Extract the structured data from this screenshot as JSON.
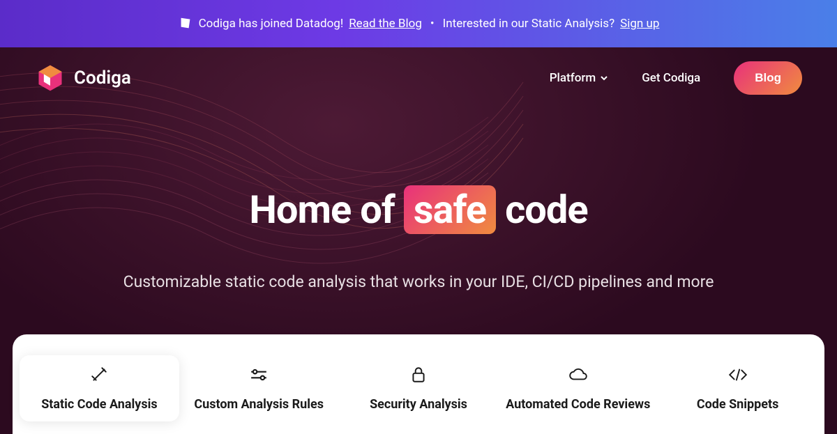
{
  "banner": {
    "joined_text": "Codiga has joined Datadog!",
    "read_blog": "Read the Blog",
    "separator": "•",
    "interested": "Interested in our Static Analysis?",
    "signup": "Sign up"
  },
  "nav": {
    "brand": "Codiga",
    "platform": "Platform",
    "get_codiga": "Get Codiga",
    "blog": "Blog"
  },
  "hero": {
    "title_pre": "Home of",
    "title_highlight": "safe",
    "title_post": "code",
    "subtitle": "Customizable static code analysis that works in your IDE, CI/CD pipelines and more"
  },
  "tabs": [
    {
      "label": "Static Code Analysis"
    },
    {
      "label": "Custom Analysis Rules"
    },
    {
      "label": "Security Analysis"
    },
    {
      "label": "Automated Code Reviews"
    },
    {
      "label": "Code Snippets"
    }
  ]
}
